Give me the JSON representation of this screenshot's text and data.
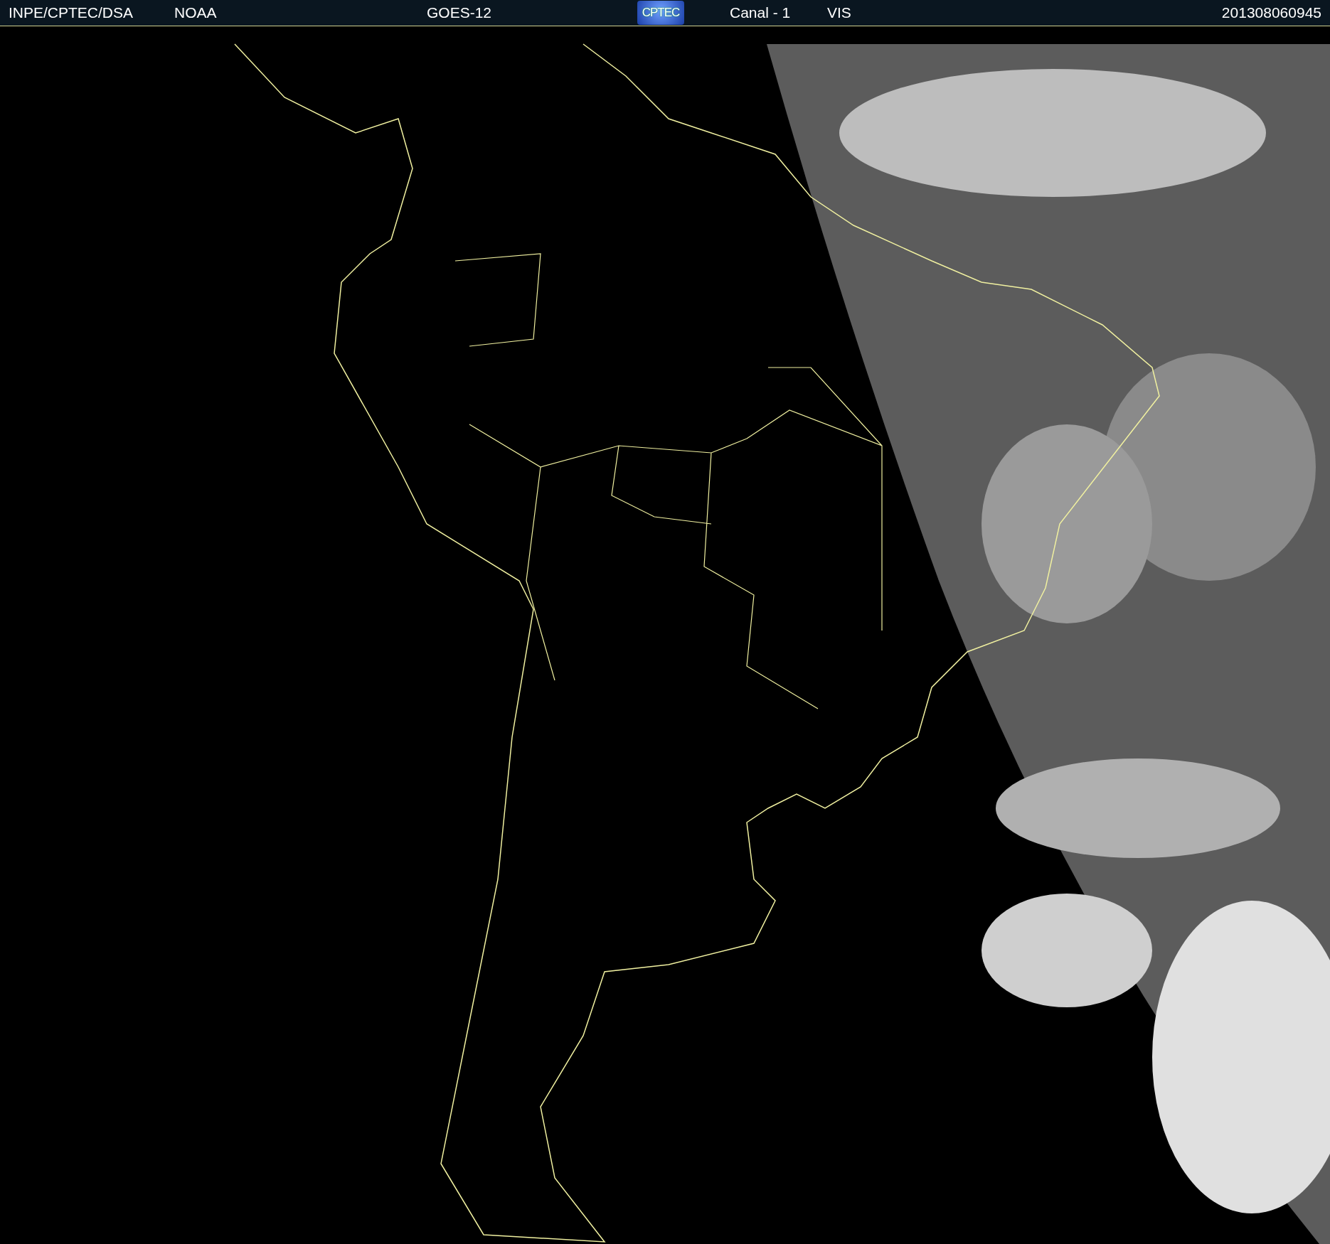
{
  "header": {
    "source": "INPE/CPTEC/DSA",
    "agency": "NOAA",
    "satellite": "GOES-12",
    "logo": "CPTEC",
    "channel": "Canal - 1",
    "band": "VIS",
    "timestamp": "201308060945"
  }
}
